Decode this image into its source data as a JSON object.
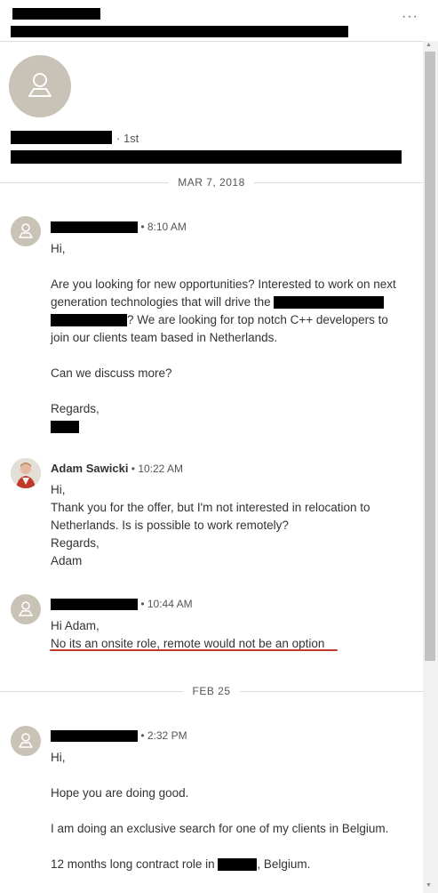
{
  "header": {
    "more_label": "···"
  },
  "profile": {
    "degree": "· 1st"
  },
  "dividers": {
    "first": "MAR 7, 2018",
    "second": "FEB 25"
  },
  "messages": [
    {
      "time": "• 8:10 AM",
      "lines": [
        "Hi,",
        "Are you looking for new opportunities? Interested to work on next",
        "generation technologies that will drive the",
        "? We are looking for top notch C++ developers to",
        "join our clients team based in Netherlands.",
        "Can we discuss more?",
        "Regards,"
      ]
    },
    {
      "name": "Adam Sawicki",
      "time": "• 10:22 AM",
      "lines": [
        "Hi,",
        "Thank you for the offer, but I'm not interested in relocation to",
        "Netherlands. Is is possible to work remotely?",
        "Regards,",
        "Adam"
      ]
    },
    {
      "time": "• 10:44 AM",
      "lines": [
        "Hi Adam,",
        "No its an onsite role, remote would not be an option"
      ]
    },
    {
      "time": "• 2:32 PM",
      "lines": [
        "Hi,",
        "Hope you are doing good.",
        "I am doing an exclusive search for one of my clients in Belgium.",
        "12 months long contract role in",
        ", Belgium."
      ]
    }
  ],
  "colors": {
    "underline": "#c0392b",
    "avatar": "#c9c2b6"
  },
  "icons": [
    "more-icon",
    "user-placeholder-icon",
    "adam-avatar",
    "scroll-up-arrow",
    "scroll-down-arrow"
  ]
}
